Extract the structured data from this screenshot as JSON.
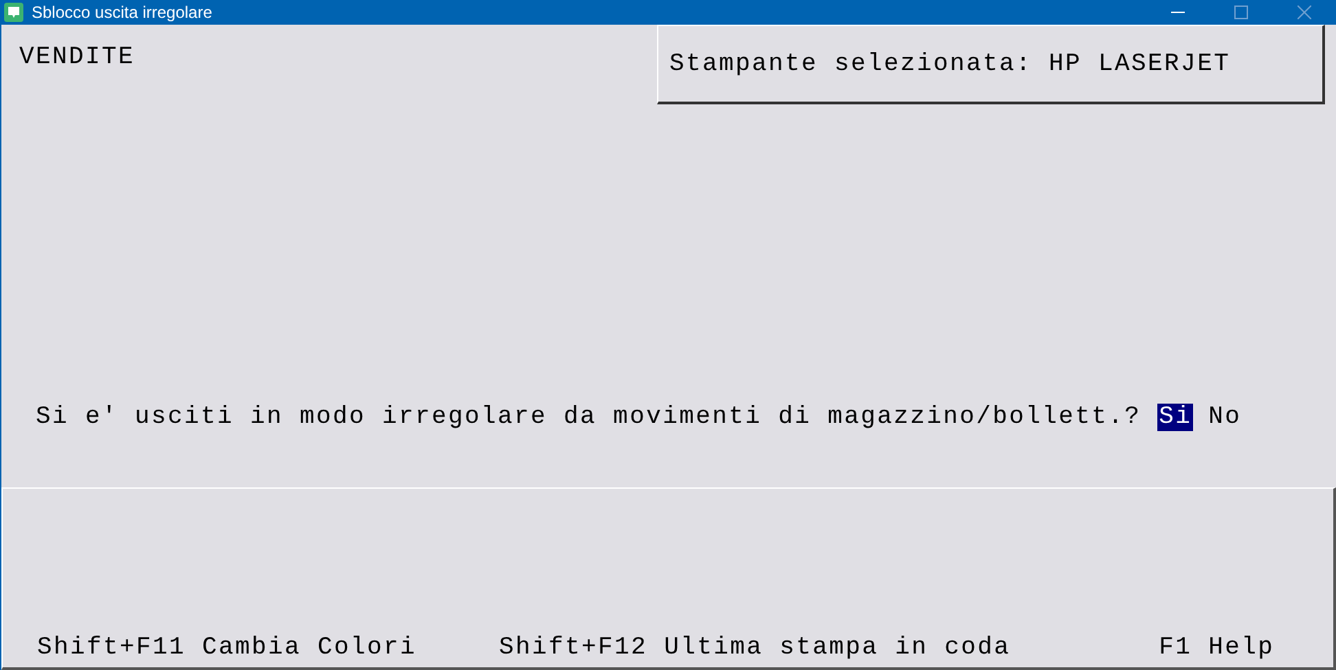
{
  "window": {
    "title": "Sblocco uscita irregolare"
  },
  "section": "VENDITE",
  "printer": {
    "label": "Stampante selezionata:",
    "value": "HP LASERJET"
  },
  "question": {
    "text": "Si e' usciti in modo irregolare da movimenti di magazzino/bollett.?",
    "answers": [
      {
        "label": "Si",
        "selected": true
      },
      {
        "label": "No",
        "selected": false
      }
    ]
  },
  "footer": [
    "Shift+F11 Cambia Colori",
    "Shift+F12 Ultima stampa in coda",
    "F1 Help"
  ]
}
